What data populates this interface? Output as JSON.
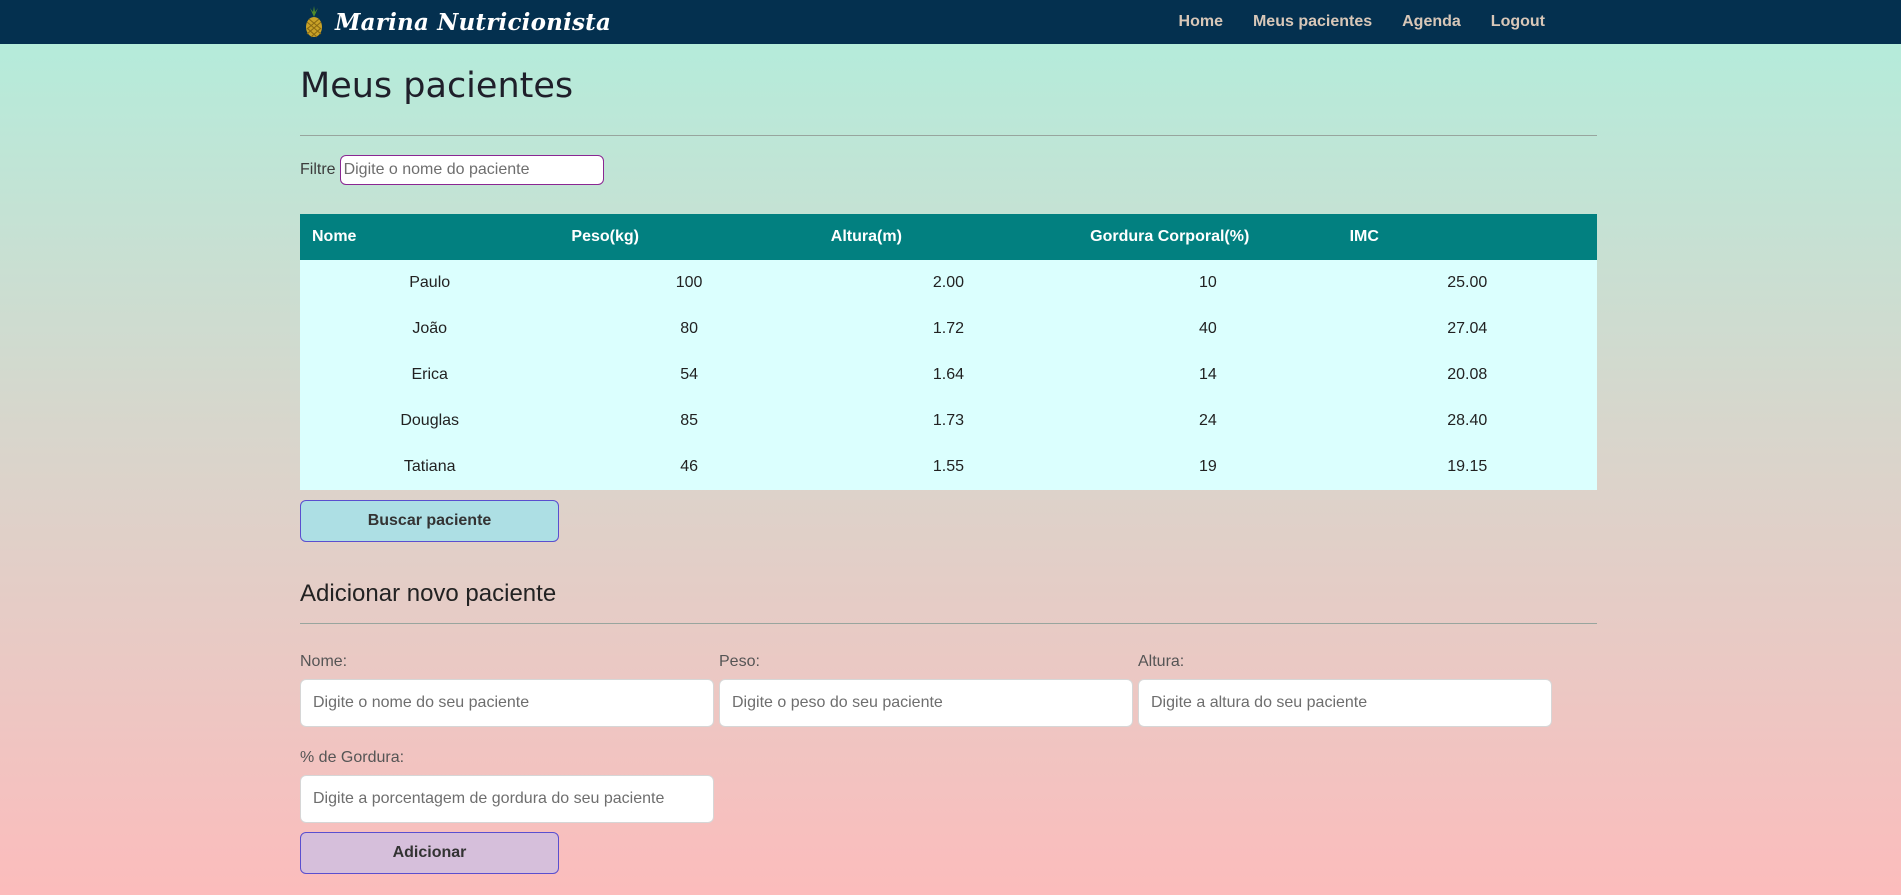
{
  "brand": {
    "name": "Marina Nutricionista",
    "icon": "pineapple-icon"
  },
  "nav": [
    "Home",
    "Meus pacientes",
    "Agenda",
    "Logout"
  ],
  "page_title": "Meus pacientes",
  "filter": {
    "label": "Filtre",
    "placeholder": "Digite o nome do paciente",
    "value": ""
  },
  "table": {
    "headers": [
      "Nome",
      "Peso(kg)",
      "Altura(m)",
      "Gordura Corporal(%)",
      "IMC"
    ],
    "rows": [
      [
        "Paulo",
        "100",
        "2.00",
        "10",
        "25.00"
      ],
      [
        "João",
        "80",
        "1.72",
        "40",
        "27.04"
      ],
      [
        "Erica",
        "54",
        "1.64",
        "14",
        "20.08"
      ],
      [
        "Douglas",
        "85",
        "1.73",
        "24",
        "28.40"
      ],
      [
        "Tatiana",
        "46",
        "1.55",
        "19",
        "19.15"
      ]
    ]
  },
  "search_button": "Buscar paciente",
  "add_section": {
    "title": "Adicionar novo paciente",
    "fields": {
      "nome": {
        "label": "Nome:",
        "placeholder": "Digite o nome do seu paciente"
      },
      "peso": {
        "label": "Peso:",
        "placeholder": "Digite o peso do seu paciente"
      },
      "altura": {
        "label": "Altura:",
        "placeholder": "Digite a altura do seu paciente"
      },
      "gordura": {
        "label": "% de Gordura:",
        "placeholder": "Digite a porcentagem de gordura do seu paciente"
      }
    },
    "submit_button": "Adicionar"
  },
  "colors": {
    "navbar": "#04304f",
    "table_header": "#028080",
    "table_body": "#dbfffe",
    "search_button": "#addfe4",
    "add_button": "#d6bfdb",
    "filter_border": "#8a2792"
  }
}
